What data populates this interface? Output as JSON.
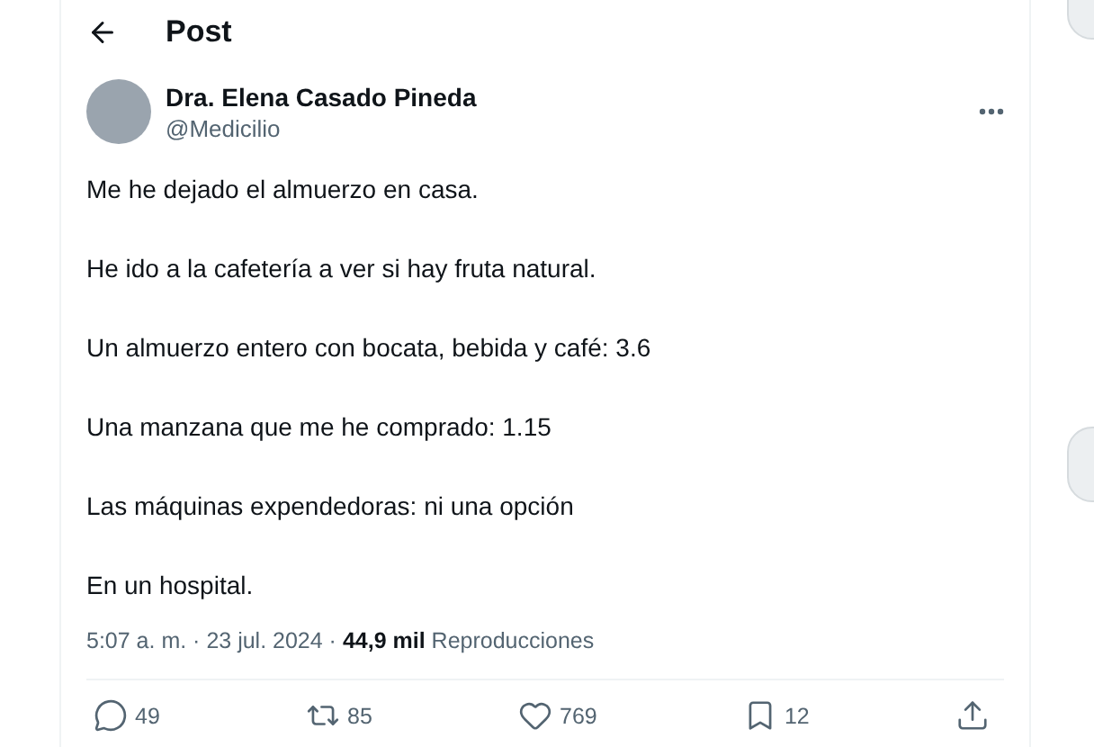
{
  "header": {
    "title": "Post"
  },
  "author": {
    "name": "Dra. Elena Casado Pineda",
    "handle": "@Medicilio"
  },
  "paragraphs": [
    "Me he dejado el almuerzo en casa.",
    "He ido a la cafetería a ver si hay fruta natural.",
    "Un almuerzo entero con bocata, bebida y café: 3.6",
    "Una manzana que me he comprado: 1.15",
    "Las máquinas expendedoras: ni una opción",
    "En un hospital."
  ],
  "meta": "5:07 a. m. · 23 jul. 2024 · **44,9 mil** Reproducciones",
  "actions": [
    {
      "kind": "reply",
      "count": "49"
    },
    {
      "kind": "repost",
      "count": "85"
    },
    {
      "kind": "like",
      "count": "769"
    },
    {
      "kind": "bookmark",
      "count": "12"
    },
    {
      "kind": "share"
    }
  ]
}
